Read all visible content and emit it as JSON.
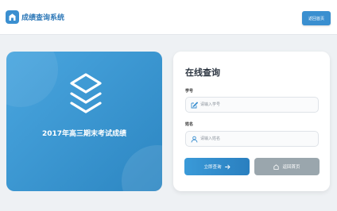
{
  "header": {
    "logo_icon": "home-icon",
    "title": "成绩查询系统",
    "home_button": "返回首页"
  },
  "hero": {
    "icon": "layers-icon",
    "title": "2017年高三期末考试成绩"
  },
  "form": {
    "title": "在线查询",
    "student_id": {
      "label": "学号",
      "icon": "edit-icon",
      "placeholder": "请输入学号",
      "value": ""
    },
    "name": {
      "label": "姓名",
      "icon": "user-icon",
      "placeholder": "请输入姓名",
      "value": ""
    },
    "query_button": "立即查询",
    "query_icon": "arrow-right-icon",
    "back_button": "返回首页",
    "back_icon": "home-icon"
  },
  "colors": {
    "accent": "#3a8fd0",
    "hero_start": "#4aa6df",
    "hero_end": "#2c86c2",
    "back_button": "#9aa6ad",
    "background": "#eef1f4"
  }
}
